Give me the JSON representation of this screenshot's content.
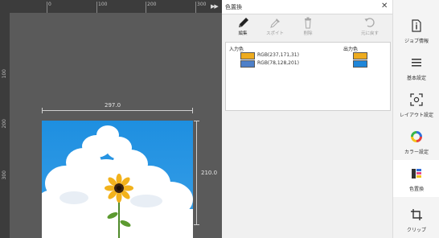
{
  "canvas": {
    "ruler_h_ticks": [
      "0",
      "100",
      "200",
      "300"
    ],
    "ruler_v_ticks": [
      "100",
      "200",
      "300"
    ],
    "width_label": "297.0",
    "height_label": "210.0"
  },
  "dialog": {
    "title": "色置換",
    "tools": [
      {
        "label": "編集",
        "icon": "pen-icon",
        "enabled": true
      },
      {
        "label": "スポイト",
        "icon": "eyedropper-icon",
        "enabled": false
      },
      {
        "label": "削除",
        "icon": "trash-icon",
        "enabled": false
      },
      {
        "label": "元に戻す",
        "icon": "undo-icon",
        "enabled": false
      }
    ],
    "input_header": "入力色",
    "output_header": "出力色",
    "rows": [
      {
        "input_color": "#EDAB1F",
        "input_text": "RGB(237,171,31)",
        "output_color": "#EDAB1F"
      },
      {
        "input_color": "#4E80C9",
        "input_text": "RGB(78,128,201)",
        "output_color": "#1F86D9"
      }
    ]
  },
  "sidebar": {
    "items": [
      {
        "label": "ジョブ情報",
        "icon": "info-document-icon"
      },
      {
        "label": "基本設定",
        "icon": "list-icon"
      },
      {
        "label": "レイアウト設定",
        "icon": "layout-frame-icon"
      },
      {
        "label": "カラー設定",
        "icon": "color-ring-icon"
      },
      {
        "label": "色置換",
        "icon": "color-replace-icon",
        "active": true
      },
      {
        "label": "クリップ",
        "icon": "crop-icon"
      }
    ]
  },
  "colors": {
    "canvas_bg": "#5A5A5A",
    "ruler_bg": "#3C3C3C",
    "sky_blue": "#1E8FE0",
    "accent_blue": "#1F86D9"
  }
}
